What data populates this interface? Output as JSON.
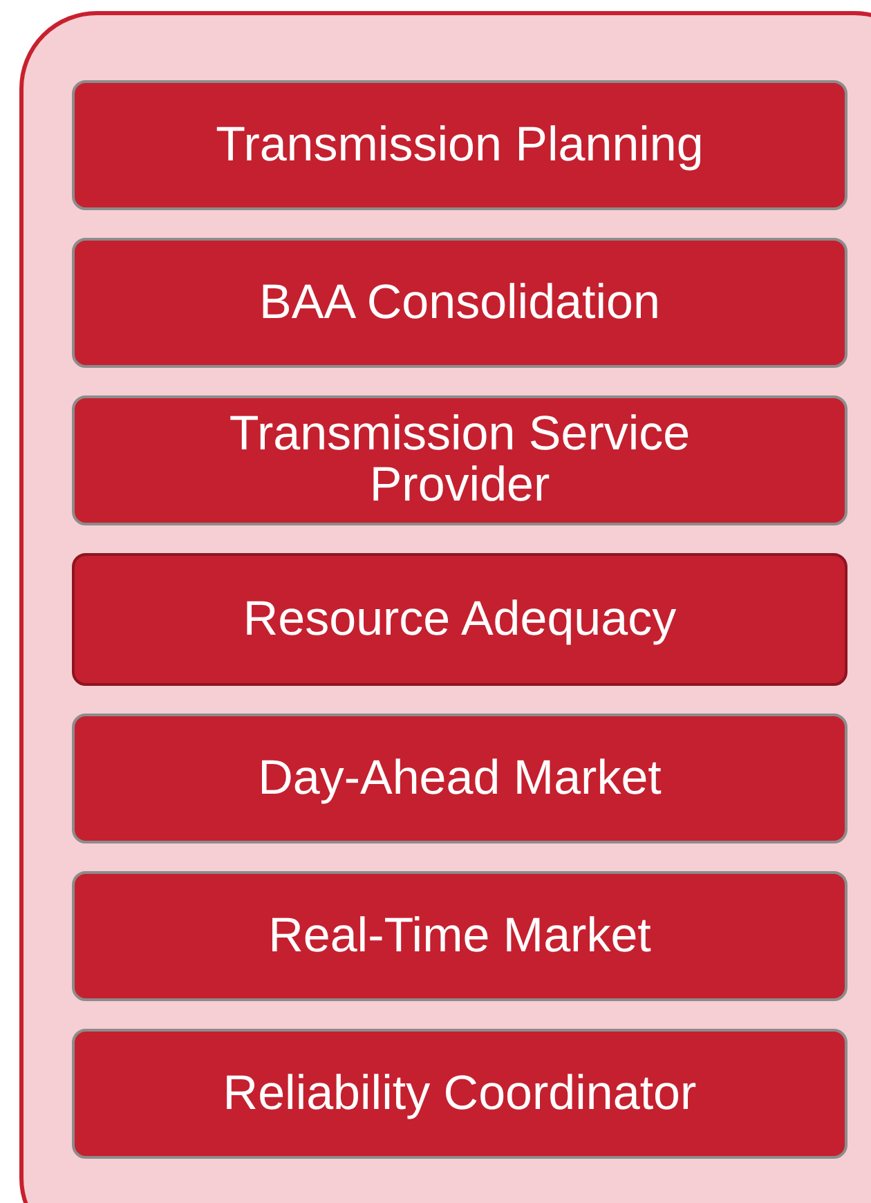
{
  "items": [
    {
      "label": "Transmission Planning",
      "selected": false
    },
    {
      "label": "BAA Consolidation",
      "selected": false
    },
    {
      "label": "Transmission Service Provider",
      "selected": false
    },
    {
      "label": "Resource Adequacy",
      "selected": true
    },
    {
      "label": "Day-Ahead Market",
      "selected": false
    },
    {
      "label": "Real-Time Market",
      "selected": false
    },
    {
      "label": "Reliability Coordinator",
      "selected": false
    }
  ]
}
